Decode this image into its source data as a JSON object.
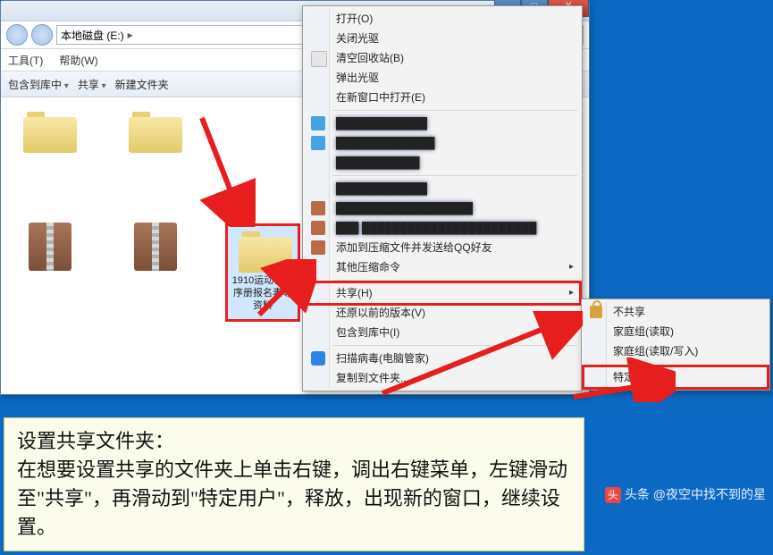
{
  "window": {
    "min": "─",
    "max": "□",
    "close": "X",
    "nav_back_icon": "◄",
    "nav_fwd_icon": "►",
    "breadcrumb_root": "本地磁盘 (E:)",
    "breadcrumb_chev": "▸",
    "menu": {
      "tools": "工具(T)",
      "help": "帮助(W)"
    },
    "toolbar": {
      "include": "包含到库中",
      "share": "共享",
      "newfolder": "新建文件夹"
    }
  },
  "icons": {
    "folder1": "",
    "folder2": "",
    "archive1": "",
    "archive2": "",
    "selected_label": "1910运动会秩序册报名表等资料"
  },
  "context": {
    "open": "打开(O)",
    "close_drive": "关闭光驱",
    "empty_bin": "清空回收站(B)",
    "eject": "弹出光驱",
    "new_window": "在新窗口中打开(E)",
    "blur1": "████████████",
    "blur2": "█████████████",
    "blur3": "███████████",
    "blur4": "████████████",
    "blur5": "██████████████████",
    "blur6": "███  ███████████████████████",
    "add_qq": "添加到压缩文件并发送给QQ好友",
    "other_compress": "其他压缩命令",
    "share": "共享(H)",
    "restore": "还原以前的版本(V)",
    "include_lib": "包含到库中(I)",
    "scan": "扫描病毒(电脑管家)",
    "copy_folder": "复制到文件夹..."
  },
  "submenu": {
    "no_share": "不共享",
    "homegroup_read": "家庭组(读取)",
    "homegroup_rw": "家庭组(读取/写入)",
    "specific_user": "特定用户..."
  },
  "annotation": {
    "title": "设置共享文件夹：",
    "body": "在想要设置共享的文件夹上单击右键，调出右键菜单，左键滑动至\"共享\"，再滑动到\"特定用户\"，释放，出现新的窗口，继续设置。"
  },
  "watermark": {
    "prefix": "头条",
    "text": "@夜空中找不到的星"
  }
}
